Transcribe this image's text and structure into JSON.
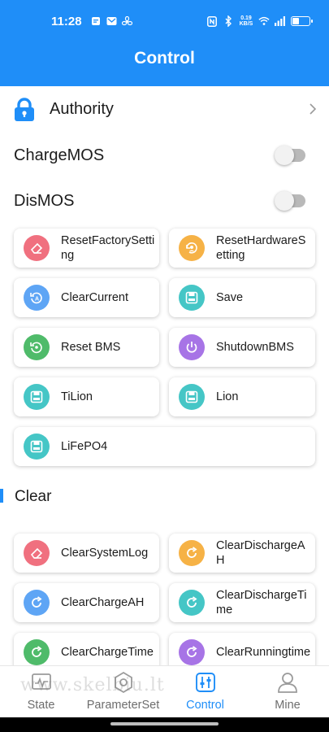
{
  "status_bar": {
    "time": "11:28",
    "net_speed_value": "0.19",
    "net_speed_unit": "KB/S",
    "battery_level": 0.4,
    "icons_left": [
      "message-icon",
      "mail-icon",
      "fan-icon"
    ],
    "icons_right": [
      "nfc-icon",
      "bluetooth-icon",
      "wifi-icon",
      "signal-icon",
      "battery-icon"
    ]
  },
  "header": {
    "title": "Control"
  },
  "authority": {
    "label": "Authority"
  },
  "toggles": [
    {
      "label": "ChargeMOS",
      "on": false
    },
    {
      "label": "DisMOS",
      "on": false
    }
  ],
  "control_buttons": [
    {
      "label": "ResetFactorySetting",
      "icon": "eraser-icon",
      "color": "#f0707f"
    },
    {
      "label": "ResetHardwareSetting",
      "icon": "reset-hardware-icon",
      "color": "#f6b246"
    },
    {
      "label": "ClearCurrent",
      "icon": "clear-current-icon",
      "color": "#5ea5f5"
    },
    {
      "label": "Save",
      "icon": "save-icon",
      "color": "#45c6c6"
    },
    {
      "label": "Reset BMS",
      "icon": "reset-icon",
      "color": "#4fbb6a"
    },
    {
      "label": "ShutdownBMS",
      "icon": "power-icon",
      "color": "#a774e6"
    },
    {
      "label": "TiLion",
      "icon": "save-icon",
      "color": "#45c6c6"
    },
    {
      "label": "Lion",
      "icon": "save-icon",
      "color": "#45c6c6"
    },
    {
      "label": "LiFePO4",
      "icon": "save-icon",
      "color": "#45c6c6"
    }
  ],
  "clear_section": {
    "title": "Clear",
    "buttons": [
      {
        "label": "ClearSystemLog",
        "icon": "eraser-icon",
        "color": "#f0707f"
      },
      {
        "label": "ClearDischargeAH",
        "icon": "refresh-icon",
        "color": "#f6b246"
      },
      {
        "label": "ClearChargeAH",
        "icon": "refresh-icon",
        "color": "#5ea5f5"
      },
      {
        "label": "ClearDischargeTime",
        "icon": "refresh-icon",
        "color": "#45c6c6"
      },
      {
        "label": "ClearChargeTime",
        "icon": "refresh-icon",
        "color": "#4fbb6a"
      },
      {
        "label": "ClearRunningtime",
        "icon": "refresh-icon",
        "color": "#a774e6"
      }
    ]
  },
  "bottom_nav": {
    "items": [
      {
        "label": "State",
        "icon": "state-icon",
        "active": false
      },
      {
        "label": "ParameterSet",
        "icon": "parameter-icon",
        "active": false
      },
      {
        "label": "Control",
        "icon": "control-icon",
        "active": true
      },
      {
        "label": "Mine",
        "icon": "user-icon",
        "active": false
      }
    ]
  },
  "watermark": "www.skelbiu.lt",
  "colors": {
    "accent": "#1f8ef8"
  }
}
